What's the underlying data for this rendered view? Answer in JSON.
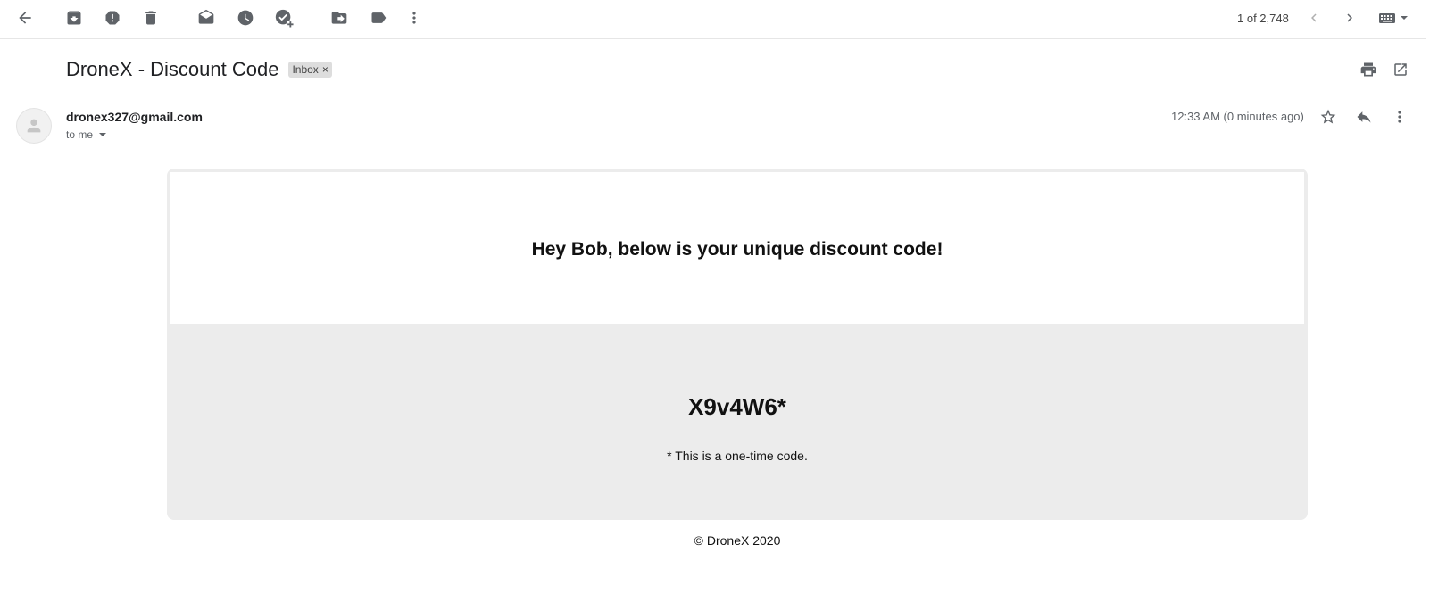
{
  "toolbar": {
    "pager_text": "1 of 2,748",
    "icons": [
      "back-arrow-icon",
      "archive-icon",
      "report-spam-icon",
      "delete-icon",
      "mark-unread-icon",
      "snooze-icon",
      "add-to-tasks-icon",
      "move-to-icon",
      "label-icon",
      "more-vert-icon",
      "newer-chevron-icon",
      "older-chevron-icon",
      "keyboard-icon"
    ]
  },
  "email": {
    "subject": "DroneX - Discount Code",
    "label_chip": "Inbox",
    "label_remove": "×",
    "sender": "dronex327@gmail.com",
    "to_line": "to me",
    "timestamp": "12:33 AM (0 minutes ago)"
  },
  "message": {
    "greeting": "Hey Bob, below is your unique discount code!",
    "code": "X9v4W6*",
    "note": "* This is a one-time code.",
    "footer": "© DroneX 2020"
  },
  "colors": {
    "icon": "#5f6368",
    "code_panel": "#ececec",
    "label_chip_bg": "#dddddd"
  }
}
